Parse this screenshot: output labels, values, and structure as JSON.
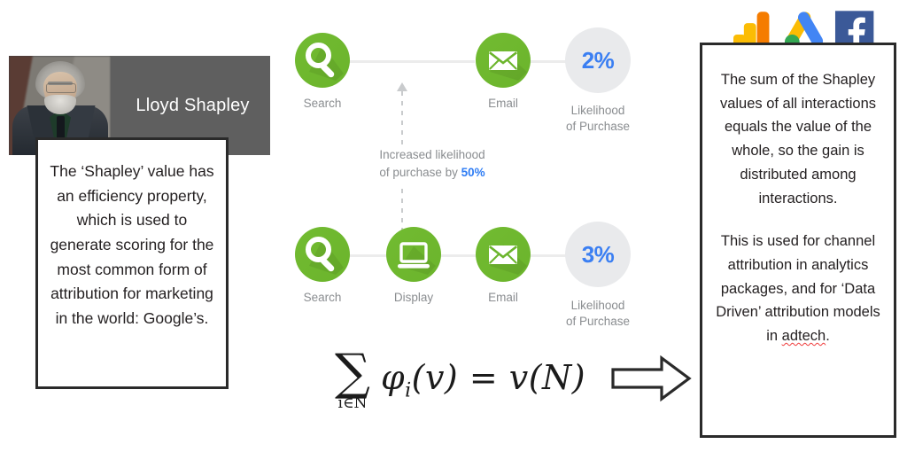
{
  "portrait": {
    "name": "Lloyd Shapley",
    "photo_alt": "lloyd-shapley-photo"
  },
  "callout_left": {
    "text": "The ‘Shapley’ value has an efficiency property, which is used to generate scoring for the most common form of attribution for marketing in the world: Google’s."
  },
  "callout_right": {
    "paragraph_1": "The sum of the Shapley values of all interactions equals the value of the whole, so the gain is distributed among interactions.",
    "paragraph_2_pre": "This is used for channel attribution in analytics packages, and for ‘Data Driven’ attribution models in ",
    "paragraph_2_spelled": "adtech",
    "paragraph_2_post": "."
  },
  "logos": [
    {
      "name": "google-analytics-logo",
      "label": "Google Analytics"
    },
    {
      "name": "google-ads-logo",
      "label": "Google Ads"
    },
    {
      "name": "facebook-logo",
      "label": "Facebook"
    }
  ],
  "diagram": {
    "annotation": {
      "line1": "Increased likelihood",
      "line2_pre": "of purchase by ",
      "line2_value": "50%"
    },
    "rows": [
      {
        "id": "row-without-display",
        "nodes": [
          {
            "icon": "search-icon",
            "label": "Search"
          },
          {
            "icon": "email-icon",
            "label": "Email"
          }
        ],
        "outcome": {
          "value": "2%",
          "label_line1": "Likelihood",
          "label_line2": "of Purchase"
        }
      },
      {
        "id": "row-with-display",
        "nodes": [
          {
            "icon": "search-icon",
            "label": "Search"
          },
          {
            "icon": "display-icon",
            "label": "Display"
          },
          {
            "icon": "email-icon",
            "label": "Email"
          }
        ],
        "outcome": {
          "value": "3%",
          "label_line1": "Likelihood",
          "label_line2": "of Purchase"
        }
      }
    ]
  },
  "formula": {
    "sigma": "∑",
    "sigma_subscript": "i∈N",
    "expression": "φ",
    "expression_sub": "i",
    "expression_rest": "(v) = v(N)",
    "arrow": "right-arrow"
  },
  "colors": {
    "green": "#6cb52d",
    "blue": "#3b7ff2",
    "gray_circle": "#e9eaec",
    "label_gray": "#8a8d90",
    "banner_gray": "#5f5f5f",
    "border_dark": "#2a2a2a",
    "spell_red": "#ef3b3b"
  }
}
